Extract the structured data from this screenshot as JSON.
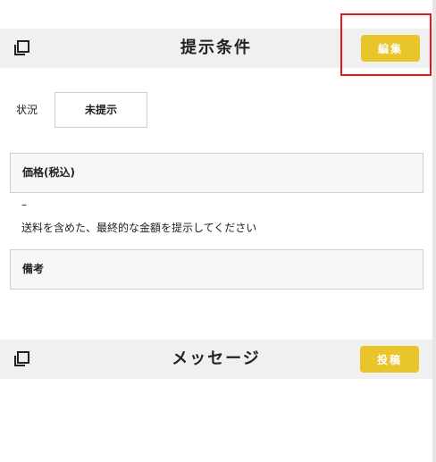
{
  "offer_section": {
    "title": "提示条件",
    "edit_label": "編集",
    "icon": "copy-icon"
  },
  "status": {
    "label": "状況",
    "value": "未提示"
  },
  "price": {
    "label": "価格(税込)",
    "value": "–",
    "note": "送料を含めた、最終的な金額を提示してください"
  },
  "remarks": {
    "label": "備考"
  },
  "message_section": {
    "title": "メッセージ",
    "post_label": "投稿",
    "icon": "copy-icon"
  },
  "colors": {
    "button": "#e8c52a",
    "highlight": "#e0191e",
    "header_bg": "#f0f0f0"
  }
}
